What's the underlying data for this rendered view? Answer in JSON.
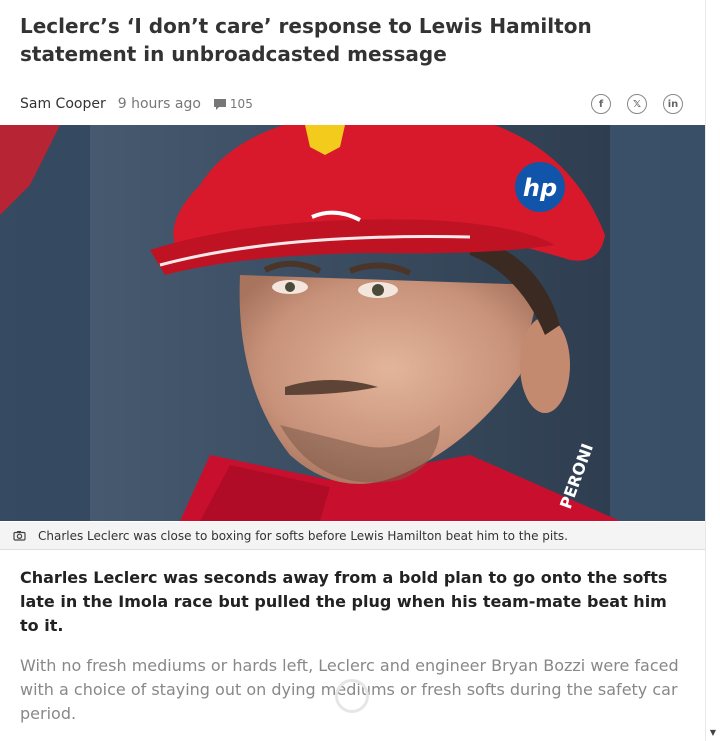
{
  "article": {
    "headline_line1": "Leclerc’s ‘I don’t care’ response to Lewis Hamilton",
    "headline_line2": "statement in unbroadcasted message",
    "author": "Sam Cooper",
    "time": "9 hours ago",
    "comment_count": "105",
    "caption": "Charles Leclerc was close to boxing for softs before Lewis Hamilton beat him to the pits.",
    "lede": "Charles Leclerc was seconds away from a bold plan to go onto the softs late in the Imola race but pulled the plug when his team-mate beat him to it.",
    "body": "With no fresh mediums or hards left, Leclerc and engineer Bryan Bozzi were faced with a choice of staying out on dying mediums or fresh softs during the safety car period."
  },
  "share": {
    "facebook_icon": "f",
    "x_icon": "𝕏",
    "linkedin_icon": "in"
  },
  "hero": {
    "cap_logo": "hp",
    "helmet_color": "#d8192b",
    "suit_color": "#c8102e"
  }
}
